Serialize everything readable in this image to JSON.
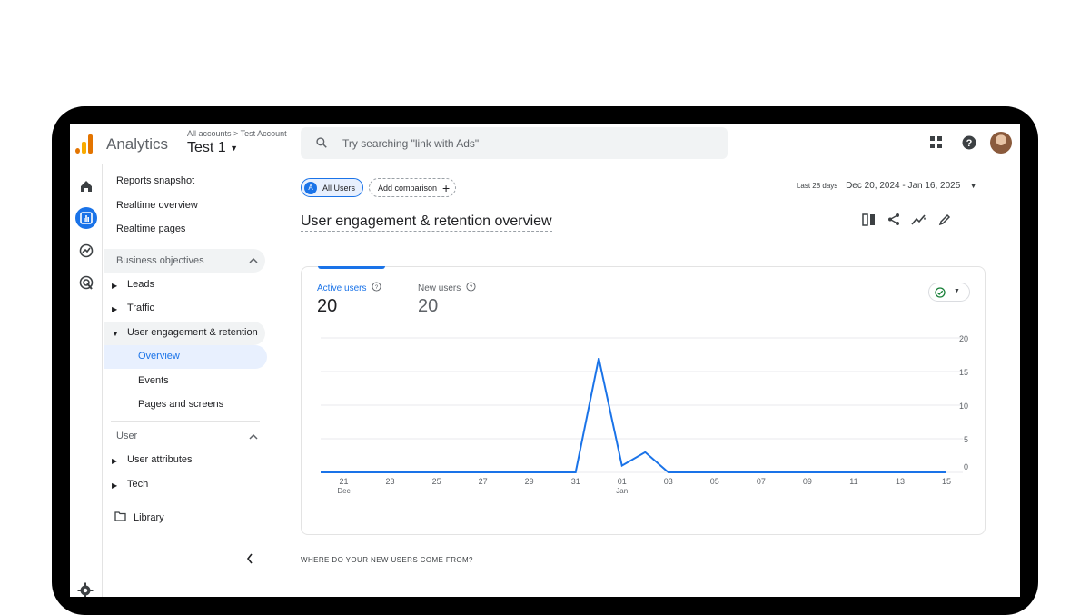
{
  "header": {
    "app_name": "Analytics",
    "breadcrumb": "All accounts > Test Account",
    "account": "Test 1",
    "search_placeholder": "Try searching \"link with Ads\""
  },
  "nav": {
    "top_items": [
      "Reports snapshot",
      "Realtime overview",
      "Realtime pages"
    ],
    "business_objectives": "Business objectives",
    "leads": "Leads",
    "traffic": "Traffic",
    "engagement": "User engagement & retention",
    "overview": "Overview",
    "events": "Events",
    "pages": "Pages and screens",
    "user": "User",
    "user_attributes": "User attributes",
    "tech": "Tech",
    "library": "Library"
  },
  "toolbar": {
    "all_users_letter": "A",
    "all_users": "All Users",
    "add_comparison": "Add comparison",
    "date_label": "Last 28 days",
    "date_range": "Dec 20, 2024 - Jan 16, 2025"
  },
  "page": {
    "title": "User engagement & retention overview"
  },
  "metrics": {
    "active_label": "Active users",
    "active_value": "20",
    "new_label": "New users",
    "new_value": "20"
  },
  "chart_data": {
    "type": "line",
    "x_ticks": [
      "21",
      "23",
      "25",
      "27",
      "29",
      "31",
      "01",
      "03",
      "05",
      "07",
      "09",
      "11",
      "13",
      "15"
    ],
    "x_subticks": {
      "21": "Dec",
      "01": "Jan"
    },
    "y_ticks": [
      "20",
      "15",
      "10",
      "5",
      "0"
    ],
    "ylim": [
      0,
      20
    ],
    "series": [
      {
        "x": [
          "2024-12-20",
          "2024-12-21",
          "2024-12-22",
          "2024-12-23",
          "2024-12-24",
          "2024-12-25",
          "2024-12-26",
          "2024-12-27",
          "2024-12-28",
          "2024-12-29",
          "2024-12-30",
          "2024-12-31",
          "2025-01-01",
          "2025-01-02",
          "2025-01-03",
          "2025-01-04",
          "2025-01-05",
          "2025-01-06",
          "2025-01-07",
          "2025-01-08",
          "2025-01-09",
          "2025-01-10",
          "2025-01-11",
          "2025-01-12",
          "2025-01-13",
          "2025-01-14",
          "2025-01-15",
          "2025-01-16"
        ],
        "values": [
          0,
          0,
          0,
          0,
          0,
          0,
          0,
          0,
          0,
          0,
          0,
          0,
          17,
          1,
          3,
          0,
          0,
          0,
          0,
          0,
          0,
          0,
          0,
          0,
          0,
          0,
          0,
          0
        ],
        "color": "#1a73e8"
      }
    ]
  },
  "footer": {
    "section_label": "WHERE DO YOUR NEW USERS COME FROM?"
  },
  "colors": {
    "accent": "#1a73e8",
    "logo_orange": "#f9ab00",
    "logo_dark": "#e37400"
  }
}
